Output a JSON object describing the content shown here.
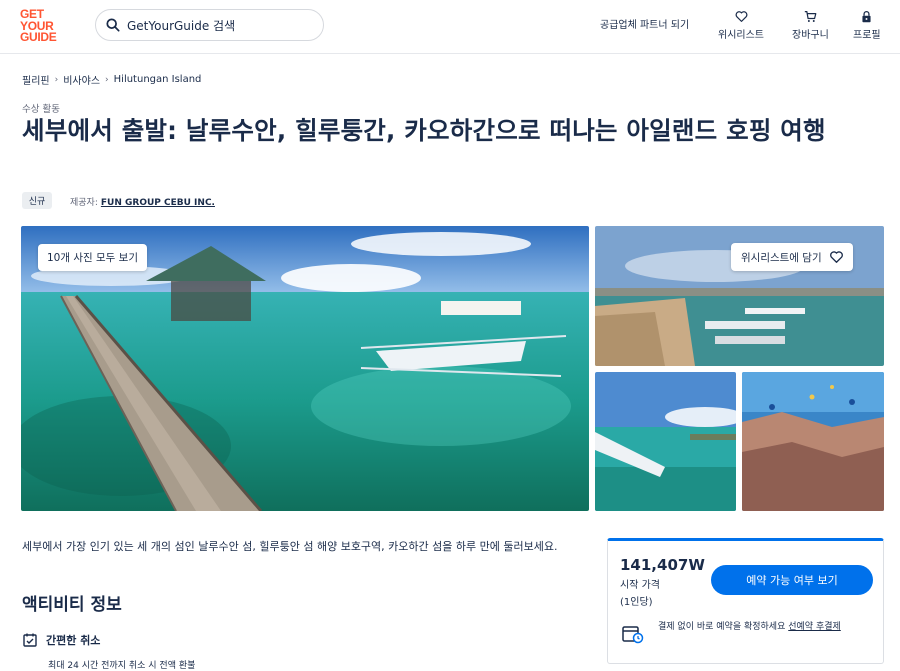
{
  "header": {
    "logo_lines": [
      "GET",
      "YOUR",
      "GUIDE"
    ],
    "search_placeholder": "GetYourGuide 검색",
    "partner_link": "공급업체 파트너 되기",
    "nav": [
      {
        "label": "위시리스트",
        "icon": "heart-icon"
      },
      {
        "label": "장바구니",
        "icon": "cart-icon"
      },
      {
        "label": "프로필",
        "icon": "lock-icon"
      }
    ]
  },
  "breadcrumb": [
    "필리핀",
    "비사야스",
    "Hilutungan Island"
  ],
  "activity": {
    "category": "수상 활동",
    "title": "세부에서 출발: 날루수안, 힐루퉁간, 카오하간으로 떠나는 아일랜드 호핑 여행",
    "badge": "신규",
    "provider_label": "제공자:",
    "provider_name": "FUN GROUP CEBU INC."
  },
  "gallery": {
    "view_all": "10개 사진 모두 보기",
    "add_wishlist": "위시리스트에 담기"
  },
  "description": "세부에서 가장 인기 있는 세 개의 섬인 날루수안 섬, 힐루퉁안 섬 해양 보호구역, 카오하간 섬을 하루 만에 둘러보세요.",
  "info": {
    "section_title": "액티비티 정보",
    "cancel_title": "간편한 취소",
    "cancel_sub": "최대 24 시간 전까지 취소 시 전액 환불"
  },
  "booking": {
    "price": "141,407W",
    "price_from": "시작 가격",
    "price_per": "(1인당)",
    "check_button": "예약 가능 여부 보기",
    "reserve_text": "결제 없이 바로 예약을 확정하세요",
    "reserve_link": "선예약 후결제"
  },
  "colors": {
    "brand": "#ff5533",
    "primary_button": "#0071eb",
    "text": "#1a2b49"
  }
}
